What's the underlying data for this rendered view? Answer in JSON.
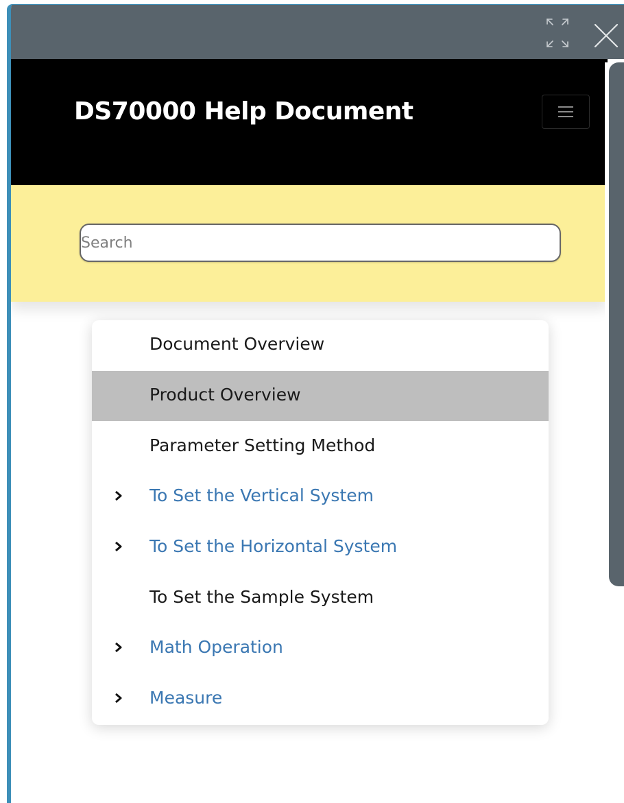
{
  "window": {
    "expand_icon": "expand-arrows-icon",
    "close_icon": "close-icon"
  },
  "header": {
    "title": "DS70000 Help Document",
    "menu_icon": "hamburger-menu-icon"
  },
  "search": {
    "placeholder": "Search",
    "value": ""
  },
  "nav": {
    "items": [
      {
        "label": "Document Overview",
        "expandable": false,
        "selected": false
      },
      {
        "label": "Product Overview",
        "expandable": false,
        "selected": true
      },
      {
        "label": "Parameter Setting Method",
        "expandable": false,
        "selected": false
      },
      {
        "label": "To Set the Vertical System",
        "expandable": true,
        "selected": false
      },
      {
        "label": "To Set the Horizontal System",
        "expandable": true,
        "selected": false
      },
      {
        "label": "To Set the Sample System",
        "expandable": false,
        "selected": false
      },
      {
        "label": "Math Operation",
        "expandable": true,
        "selected": false
      },
      {
        "label": "Measure",
        "expandable": true,
        "selected": false
      }
    ]
  },
  "colors": {
    "titlebar": "#59646c",
    "header_bg": "#000000",
    "search_bg": "#fcef99",
    "link": "#3a77b2",
    "selected_bg": "#bebebe",
    "window_border": "#3d8fb8"
  }
}
